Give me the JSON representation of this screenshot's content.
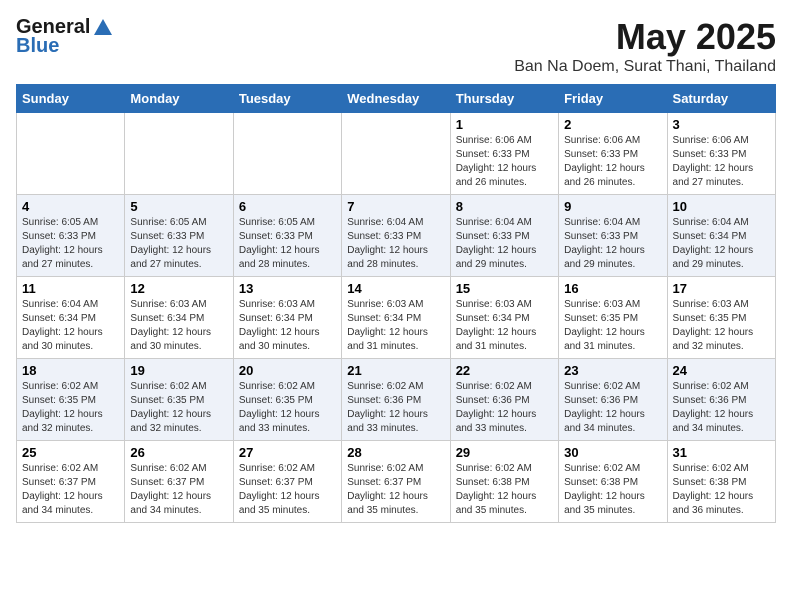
{
  "header": {
    "logo_general": "General",
    "logo_blue": "Blue",
    "title": "May 2025",
    "location": "Ban Na Doem, Surat Thani, Thailand"
  },
  "days_of_week": [
    "Sunday",
    "Monday",
    "Tuesday",
    "Wednesday",
    "Thursday",
    "Friday",
    "Saturday"
  ],
  "weeks": [
    [
      {
        "day": "",
        "info": ""
      },
      {
        "day": "",
        "info": ""
      },
      {
        "day": "",
        "info": ""
      },
      {
        "day": "",
        "info": ""
      },
      {
        "day": "1",
        "info": "Sunrise: 6:06 AM\nSunset: 6:33 PM\nDaylight: 12 hours and 26 minutes."
      },
      {
        "day": "2",
        "info": "Sunrise: 6:06 AM\nSunset: 6:33 PM\nDaylight: 12 hours and 26 minutes."
      },
      {
        "day": "3",
        "info": "Sunrise: 6:06 AM\nSunset: 6:33 PM\nDaylight: 12 hours and 27 minutes."
      }
    ],
    [
      {
        "day": "4",
        "info": "Sunrise: 6:05 AM\nSunset: 6:33 PM\nDaylight: 12 hours and 27 minutes."
      },
      {
        "day": "5",
        "info": "Sunrise: 6:05 AM\nSunset: 6:33 PM\nDaylight: 12 hours and 27 minutes."
      },
      {
        "day": "6",
        "info": "Sunrise: 6:05 AM\nSunset: 6:33 PM\nDaylight: 12 hours and 28 minutes."
      },
      {
        "day": "7",
        "info": "Sunrise: 6:04 AM\nSunset: 6:33 PM\nDaylight: 12 hours and 28 minutes."
      },
      {
        "day": "8",
        "info": "Sunrise: 6:04 AM\nSunset: 6:33 PM\nDaylight: 12 hours and 29 minutes."
      },
      {
        "day": "9",
        "info": "Sunrise: 6:04 AM\nSunset: 6:33 PM\nDaylight: 12 hours and 29 minutes."
      },
      {
        "day": "10",
        "info": "Sunrise: 6:04 AM\nSunset: 6:34 PM\nDaylight: 12 hours and 29 minutes."
      }
    ],
    [
      {
        "day": "11",
        "info": "Sunrise: 6:04 AM\nSunset: 6:34 PM\nDaylight: 12 hours and 30 minutes."
      },
      {
        "day": "12",
        "info": "Sunrise: 6:03 AM\nSunset: 6:34 PM\nDaylight: 12 hours and 30 minutes."
      },
      {
        "day": "13",
        "info": "Sunrise: 6:03 AM\nSunset: 6:34 PM\nDaylight: 12 hours and 30 minutes."
      },
      {
        "day": "14",
        "info": "Sunrise: 6:03 AM\nSunset: 6:34 PM\nDaylight: 12 hours and 31 minutes."
      },
      {
        "day": "15",
        "info": "Sunrise: 6:03 AM\nSunset: 6:34 PM\nDaylight: 12 hours and 31 minutes."
      },
      {
        "day": "16",
        "info": "Sunrise: 6:03 AM\nSunset: 6:35 PM\nDaylight: 12 hours and 31 minutes."
      },
      {
        "day": "17",
        "info": "Sunrise: 6:03 AM\nSunset: 6:35 PM\nDaylight: 12 hours and 32 minutes."
      }
    ],
    [
      {
        "day": "18",
        "info": "Sunrise: 6:02 AM\nSunset: 6:35 PM\nDaylight: 12 hours and 32 minutes."
      },
      {
        "day": "19",
        "info": "Sunrise: 6:02 AM\nSunset: 6:35 PM\nDaylight: 12 hours and 32 minutes."
      },
      {
        "day": "20",
        "info": "Sunrise: 6:02 AM\nSunset: 6:35 PM\nDaylight: 12 hours and 33 minutes."
      },
      {
        "day": "21",
        "info": "Sunrise: 6:02 AM\nSunset: 6:36 PM\nDaylight: 12 hours and 33 minutes."
      },
      {
        "day": "22",
        "info": "Sunrise: 6:02 AM\nSunset: 6:36 PM\nDaylight: 12 hours and 33 minutes."
      },
      {
        "day": "23",
        "info": "Sunrise: 6:02 AM\nSunset: 6:36 PM\nDaylight: 12 hours and 34 minutes."
      },
      {
        "day": "24",
        "info": "Sunrise: 6:02 AM\nSunset: 6:36 PM\nDaylight: 12 hours and 34 minutes."
      }
    ],
    [
      {
        "day": "25",
        "info": "Sunrise: 6:02 AM\nSunset: 6:37 PM\nDaylight: 12 hours and 34 minutes."
      },
      {
        "day": "26",
        "info": "Sunrise: 6:02 AM\nSunset: 6:37 PM\nDaylight: 12 hours and 34 minutes."
      },
      {
        "day": "27",
        "info": "Sunrise: 6:02 AM\nSunset: 6:37 PM\nDaylight: 12 hours and 35 minutes."
      },
      {
        "day": "28",
        "info": "Sunrise: 6:02 AM\nSunset: 6:37 PM\nDaylight: 12 hours and 35 minutes."
      },
      {
        "day": "29",
        "info": "Sunrise: 6:02 AM\nSunset: 6:38 PM\nDaylight: 12 hours and 35 minutes."
      },
      {
        "day": "30",
        "info": "Sunrise: 6:02 AM\nSunset: 6:38 PM\nDaylight: 12 hours and 35 minutes."
      },
      {
        "day": "31",
        "info": "Sunrise: 6:02 AM\nSunset: 6:38 PM\nDaylight: 12 hours and 36 minutes."
      }
    ]
  ]
}
